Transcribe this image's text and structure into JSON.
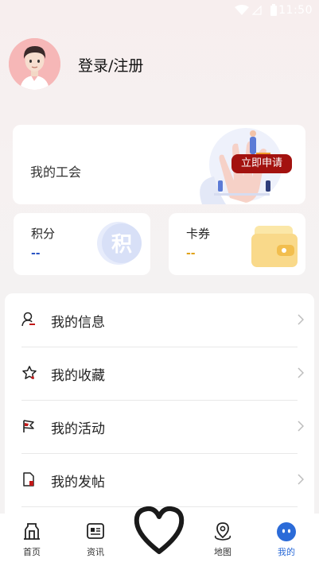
{
  "status_bar": {
    "time": "11:50"
  },
  "profile": {
    "login_label": "登录/注册"
  },
  "union_card": {
    "title": "我的工会",
    "apply_button": "立即申请"
  },
  "points_card": {
    "label": "积分",
    "value": "--",
    "value_color": "#2b55c4"
  },
  "coupons_card": {
    "label": "卡券",
    "value": "--",
    "value_color": "#e0a21a"
  },
  "menu": {
    "items": [
      {
        "label": "我的信息"
      },
      {
        "label": "我的收藏"
      },
      {
        "label": "我的活动"
      },
      {
        "label": "我的发帖"
      }
    ]
  },
  "tabbar": {
    "tabs": [
      {
        "label": "首页"
      },
      {
        "label": "资讯"
      },
      {
        "label": "地图"
      },
      {
        "label": "我的"
      }
    ],
    "active_color": "#2b6bd8"
  },
  "colors": {
    "accent": "#a3120f",
    "background": "#f4f2f2"
  }
}
